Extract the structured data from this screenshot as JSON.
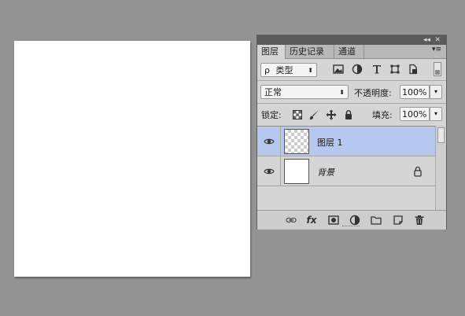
{
  "panel": {
    "title_icons": {
      "collapse": "◂◂",
      "close": "✕"
    },
    "tabs": [
      {
        "label": "图层",
        "active": true
      },
      {
        "label": "历史记录",
        "active": false
      },
      {
        "label": "通道",
        "active": false
      }
    ],
    "panel_menu_icon": "▾≡"
  },
  "filter": {
    "search_icon": "ρ",
    "kind_label": "类型",
    "icons": [
      "image-filter-icon",
      "adjustment-filter-icon",
      "type-filter-icon",
      "shape-filter-icon",
      "smart-object-filter-icon"
    ]
  },
  "blend": {
    "mode": "正常",
    "opacity_label": "不透明度:",
    "opacity_value": "100%"
  },
  "lock": {
    "label": "锁定:",
    "fill_label": "填充:",
    "fill_value": "100%"
  },
  "layers": [
    {
      "name": "图层 1",
      "selected": true,
      "transparent": true
    },
    {
      "name": "背景",
      "selected": false,
      "locked": true
    }
  ],
  "bottom_icons": [
    "link-icon",
    "fx-icon",
    "mask-icon",
    "adjustment-icon",
    "folder-icon",
    "new-layer-icon",
    "trash-icon"
  ],
  "colors": {
    "workspace": "#939393",
    "panel": "#d5d5d5",
    "selected_layer": "#b6c8ee"
  }
}
